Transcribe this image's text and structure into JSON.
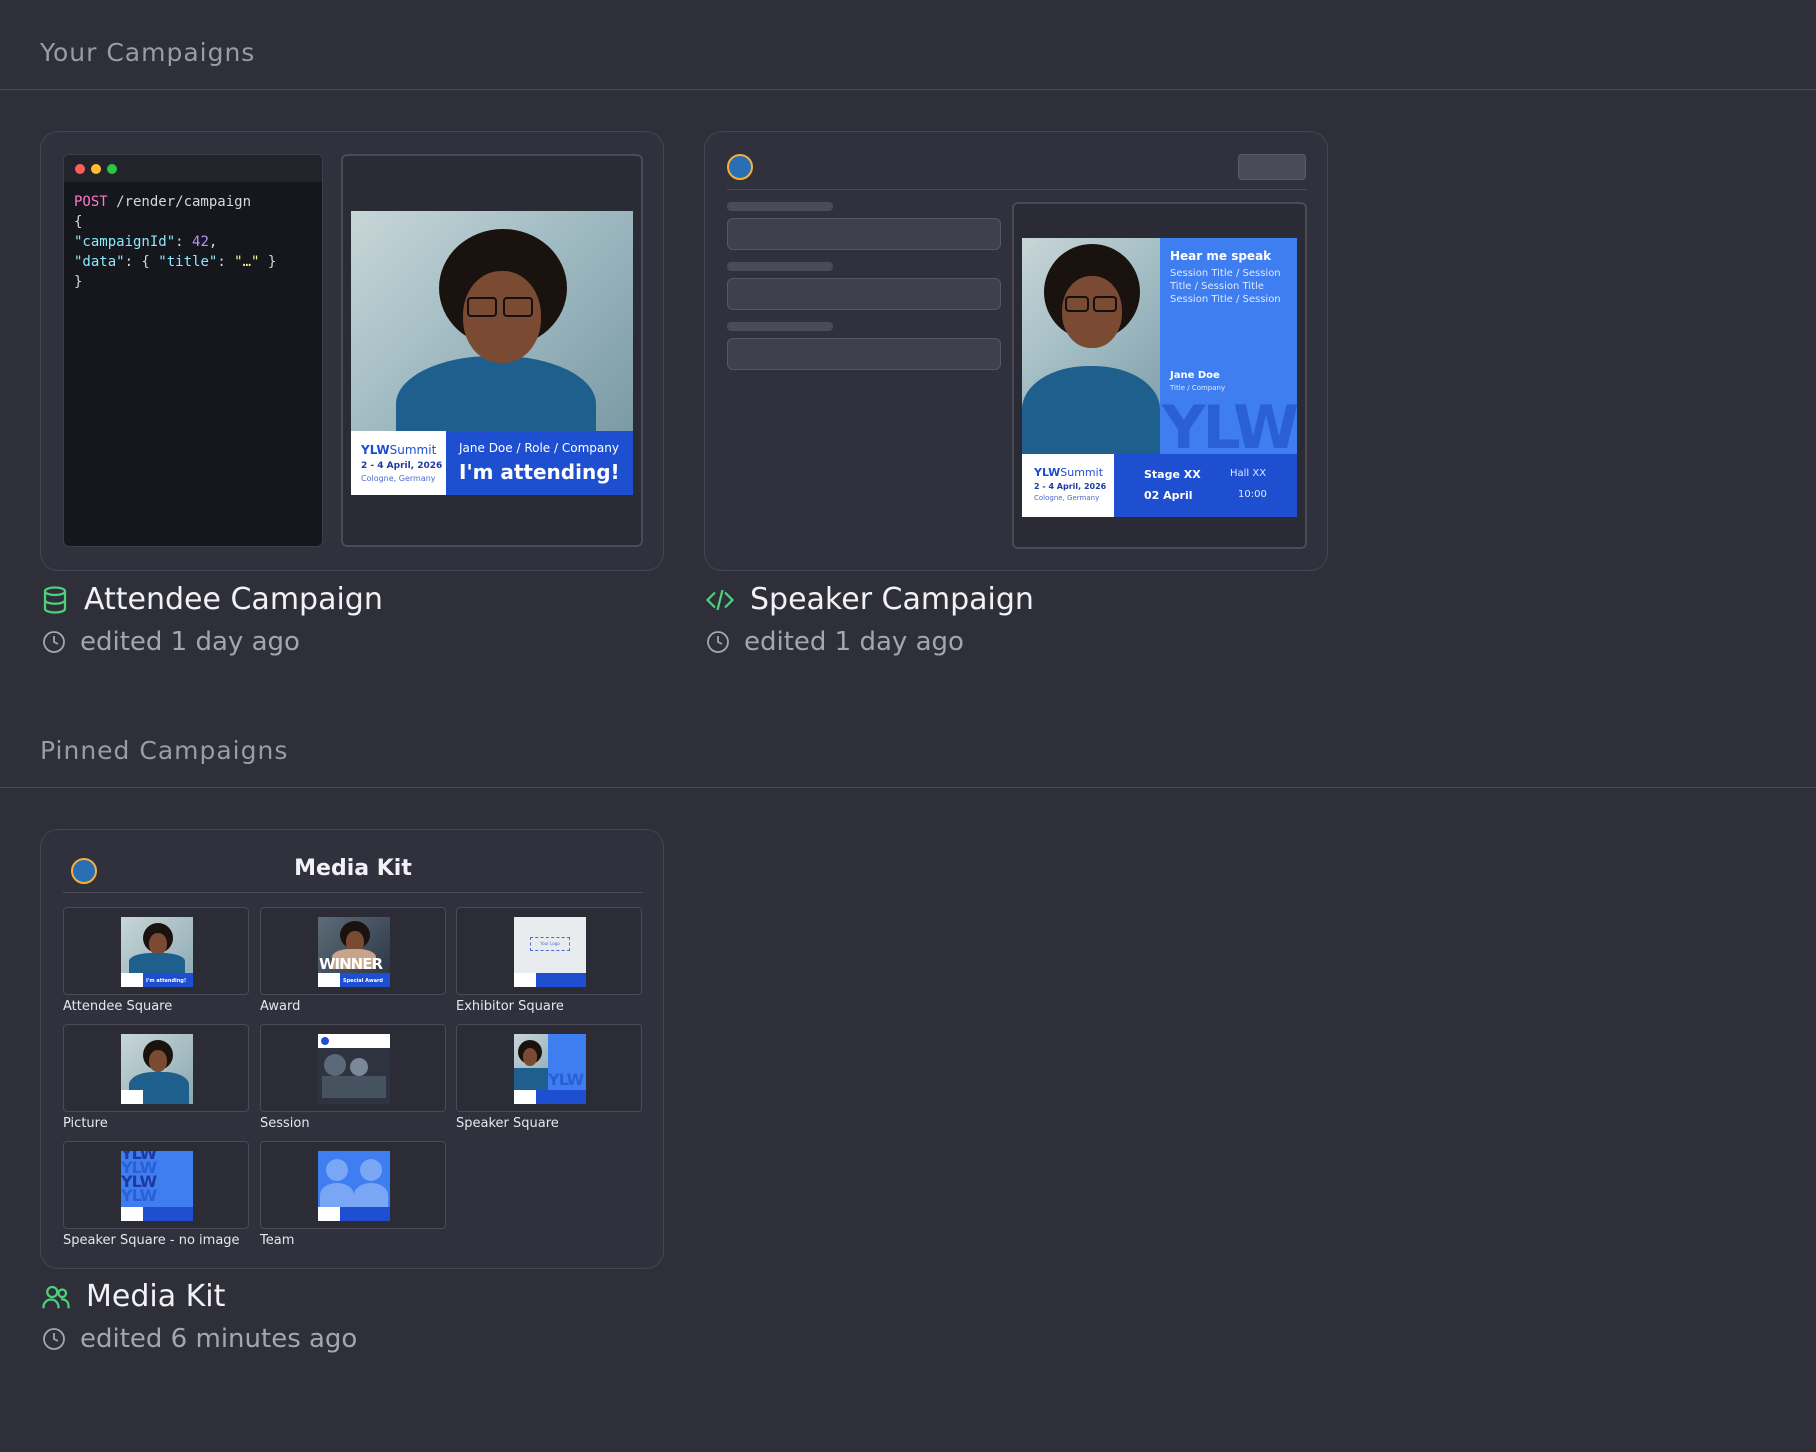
{
  "sections": {
    "your_campaigns": "Your Campaigns",
    "pinned_campaigns": "Pinned Campaigns"
  },
  "campaigns": [
    {
      "name": "Attendee Campaign",
      "icon": "database-icon",
      "edited": "edited 1 day ago",
      "code": {
        "method": "POST",
        "path": " /render/campaign",
        "line2": "{",
        "line3_key": "\"campaignId\"",
        "line3_val": "42",
        "line4_key": "\"data\"",
        "line4_inner_key": "\"title\"",
        "line4_inner_val": "\"…\"",
        "line5": "}"
      },
      "preview": {
        "brand": "YLWSummit",
        "brand_bold": "YLW",
        "brand_rest": "Summit",
        "dates": "2 - 4 April, 2026",
        "location": "Cologne, Germany",
        "person_line": "Jane Doe / Role / Company",
        "headline": "I'm attending!"
      }
    },
    {
      "name": "Speaker Campaign",
      "icon": "code-icon",
      "edited": "edited 1 day ago",
      "preview": {
        "heading": "Hear me speak",
        "session_lines": "Session Title / Session Title / Session Title Session Title / Session",
        "speaker_name": "Jane Doe",
        "speaker_title": "Title / Company",
        "big_text": "YLW",
        "brand_bold": "YLW",
        "brand_rest": "Summit",
        "dates": "2 - 4 April, 2026",
        "location": "Cologne, Germany",
        "stage": "Stage XX",
        "hall": "Hall XX",
        "date": "02 April",
        "time": "10:00"
      }
    }
  ],
  "pinned": {
    "name": "Media Kit",
    "icon": "users-icon",
    "edited": "edited 6 minutes ago",
    "panel_title": "Media Kit",
    "templates": [
      {
        "label": "Attendee Square",
        "kind": "photo"
      },
      {
        "label": "Award",
        "kind": "award"
      },
      {
        "label": "Exhibitor Square",
        "kind": "logo"
      },
      {
        "label": "Picture",
        "kind": "photo"
      },
      {
        "label": "Session",
        "kind": "session"
      },
      {
        "label": "Speaker Square",
        "kind": "speaker"
      },
      {
        "label": "Speaker Square - no image",
        "kind": "noimage"
      },
      {
        "label": "Team",
        "kind": "team"
      }
    ],
    "thumb_text": {
      "winner": "WINNER",
      "special_award": "Special Award",
      "your_logo": "Your Logo",
      "ylw": "YLW",
      "attending": "I'm attending!"
    }
  },
  "colors": {
    "background": "#2e2f39",
    "accent_green": "#4cd07a",
    "brand_blue": "#1e4fd0",
    "brand_blue_light": "#3f7ef0"
  }
}
